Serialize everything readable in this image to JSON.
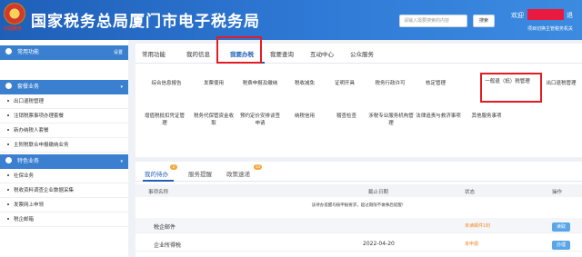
{
  "header": {
    "emblem_text": "中国税务",
    "title": "国家税务总局厦门市电子税务局",
    "search_placeholder": "请输入需要搜索的内容",
    "search_button": "搜索",
    "welcome": "欢迎",
    "logout": "退",
    "switch_link": "项目切换主管税务机关"
  },
  "sidebar": {
    "common_title": "常用功能",
    "common_action": "设置",
    "tax_title": "套餐业务",
    "tax_items": [
      "出口退税管理",
      "注销税票事项办理套餐",
      "新办纳税人套餐",
      "主附税联合申报缴纳业务"
    ],
    "special_title": "特色业务",
    "special_items": [
      "社保业务",
      "税收资料调查企业数据采集",
      "发票网上申领",
      "税企邮箱"
    ]
  },
  "tabs": [
    "常用功能",
    "我的信息",
    "我要办税",
    "我要查询",
    "互动中心",
    "公众服务"
  ],
  "services_row1": [
    "综合信息报告",
    "发票使用",
    "税费申报及缴纳",
    "税收减免",
    "证明开具",
    "税务行政许可",
    "核定管理",
    "一般退（抵）税管理",
    "出口退税管理"
  ],
  "services_row2": [
    "增值税抵扣凭证管理",
    "税务代保管资金收取",
    "预约定价安排谈签申请",
    "纳税信用",
    "稽查检查",
    "涉税专业服务机构管理",
    "法律追责与救济事项",
    "其他服务事项"
  ],
  "bottom_tabs": [
    {
      "label": "我的待办",
      "badge": "2"
    },
    {
      "label": "服务提醒",
      "badge": ""
    },
    {
      "label": "政策速递",
      "badge": "13"
    }
  ],
  "table": {
    "headers": [
      "事项名称",
      "截止日期",
      "状态",
      "操作"
    ],
    "notice": "该待办提醒均按申报要求，超过期限不做事后提醒！",
    "rows": [
      {
        "name": "税企邮件",
        "date": "",
        "status": "未读邮件1封",
        "action": "读取"
      },
      {
        "name": "企业所得税",
        "date": "2022-04-20",
        "status": "未申报",
        "action": "办理"
      }
    ]
  },
  "colors": {
    "header": "#2f7ad6",
    "accent": "#1f5fb8",
    "highlight": "#e41b23",
    "status": "#f08a24"
  }
}
